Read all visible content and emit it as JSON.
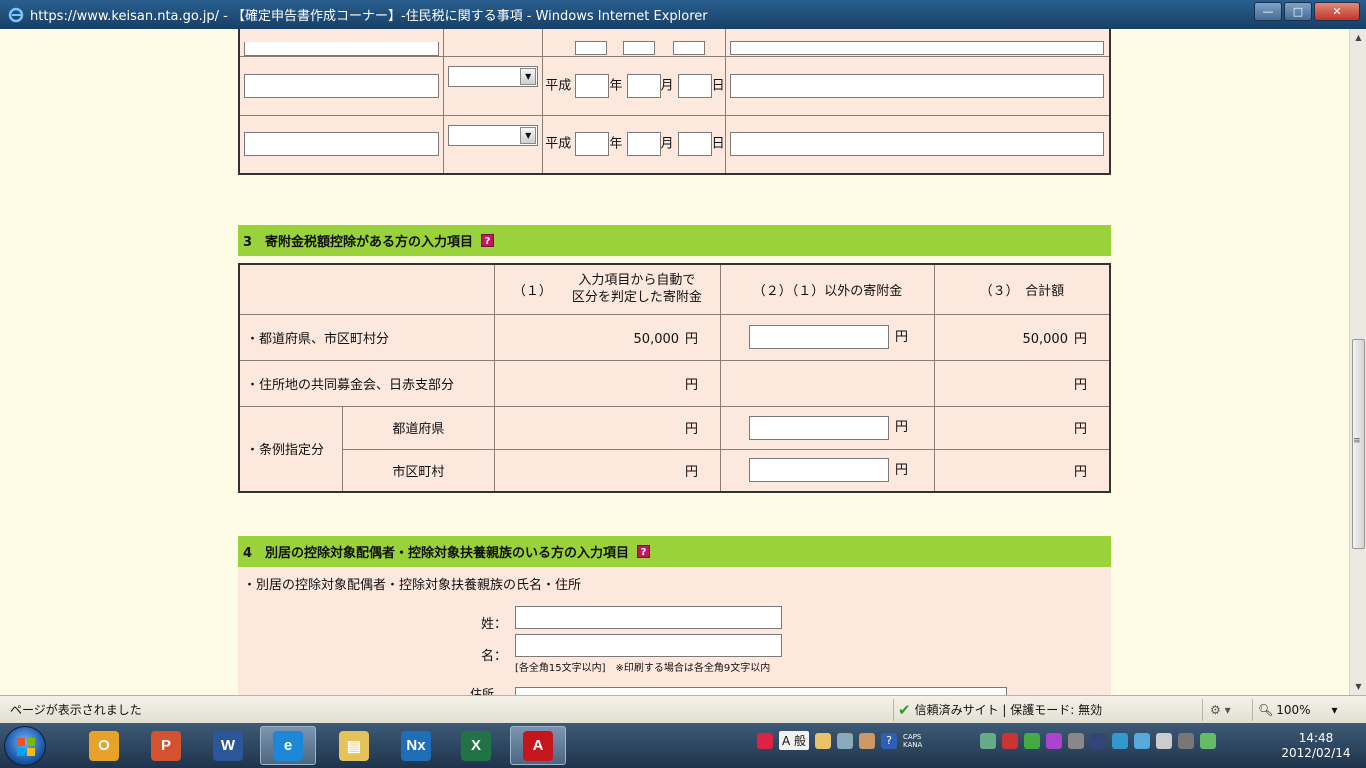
{
  "window": {
    "title": "https://www.keisan.nta.go.jp/ - 【確定申告書作成コーナー】-住民税に関する事項 - Windows Internet Explorer",
    "minimize_label": "—",
    "maximize_label": "□",
    "close_label": "✕"
  },
  "date_rows": {
    "era": "平成",
    "year_unit": "年",
    "month_unit": "月",
    "day_unit": "日"
  },
  "section3": {
    "heading": "3　寄附金税額控除がある方の入力項目",
    "help_icon": "?",
    "col1_label_a": "（１）",
    "col1_label_b1": "入力項目から自動で",
    "col1_label_b2": "区分を判定した寄附金",
    "col2_label": "（２）（１）以外の寄附金",
    "col3_label": "（３）　合計額",
    "yen": "円",
    "rows": [
      {
        "label": "・都道府県、市区町村分",
        "col1": "50,000",
        "col3": "50,000"
      },
      {
        "label": "・住所地の共同募金会、日赤支部分",
        "col1": "",
        "col3": ""
      }
    ],
    "ordinance_label": "・条例指定分",
    "ordinance_sub": [
      "都道府県",
      "市区町村"
    ]
  },
  "section4": {
    "heading": "4　別居の控除対象配偶者・控除対象扶養親族のいる方の入力項目",
    "help_icon": "?",
    "subtitle": "・別居の控除対象配偶者・控除対象扶養親族の氏名・住所",
    "surname_label": "姓：",
    "given_label": "名：",
    "note": "[各全角15文字以内]　※印刷する場合は各全角9文字以内",
    "address_label": "住所"
  },
  "statusbar": {
    "text": "ページが表示されました",
    "trust": "信頼済みサイト | 保護モード: 無効",
    "zoom": "100%"
  },
  "taskbar": {
    "ime_mode": "A 般",
    "caps": "CAPS",
    "kana": "KANA",
    "time": "14:48",
    "date": "2012/02/14"
  }
}
